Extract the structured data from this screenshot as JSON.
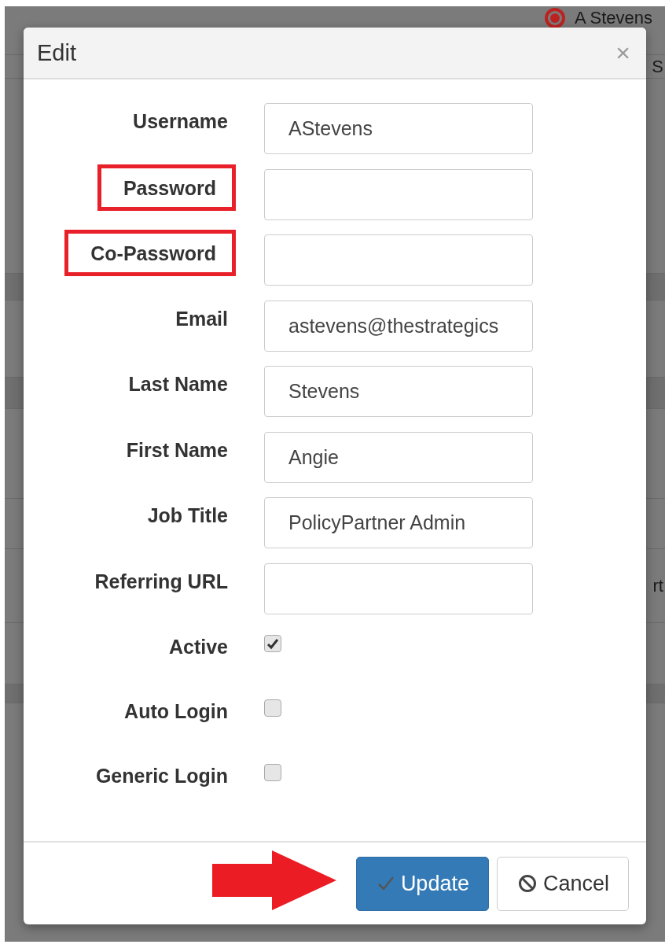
{
  "background": {
    "user_name": "A Stevens",
    "fragments": [
      "S",
      "rt"
    ]
  },
  "dialog": {
    "title": "Edit",
    "close": "×"
  },
  "fields": [
    {
      "kind": "text",
      "label": "Username",
      "value": "AStevens",
      "highlighted": false
    },
    {
      "kind": "text",
      "label": "Password",
      "highlighted": true
    },
    {
      "kind": "text",
      "label": "Co-Password",
      "highlighted": true
    },
    {
      "kind": "text",
      "label": "Email",
      "value": "astevens@thestrategics",
      "highlighted": false
    },
    {
      "kind": "text",
      "label": "Last Name",
      "value": "Stevens",
      "highlighted": false
    },
    {
      "kind": "text",
      "label": "First Name",
      "value": "Angie",
      "highlighted": false
    },
    {
      "kind": "text",
      "label": "Job Title",
      "value": "PolicyPartner Admin",
      "highlighted": false
    },
    {
      "kind": "text",
      "label": "Referring URL",
      "highlighted": false
    },
    {
      "kind": "checkbox",
      "label": "Active",
      "checked": true,
      "highlighted": false
    },
    {
      "kind": "checkbox",
      "label": "Auto Login",
      "checked": false,
      "highlighted": false
    },
    {
      "kind": "checkbox",
      "label": "Generic Login",
      "checked": false,
      "highlighted": false
    }
  ],
  "buttons": [
    {
      "kind": "primary",
      "label": "Update"
    },
    {
      "kind": "default",
      "label": "Cancel"
    }
  ],
  "annotation": {
    "arrow_to_primary": true
  }
}
